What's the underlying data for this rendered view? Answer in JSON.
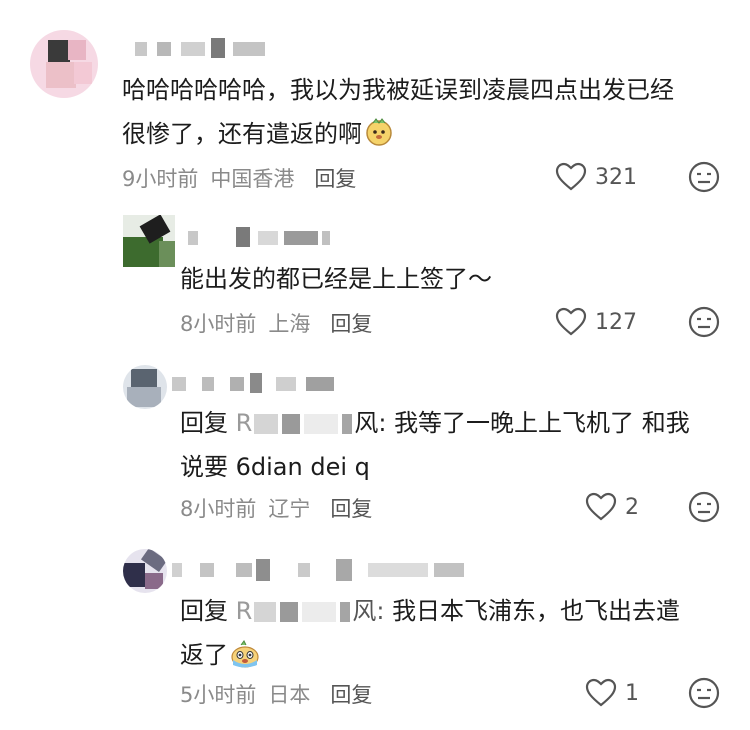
{
  "comments": [
    {
      "text_line1": "哈哈哈哈哈哈，我以为我被延误到凌晨四点出发已经",
      "text_line2": "很惨了，还有遣返的啊",
      "emoji": "face-emoji",
      "time": "9小时前",
      "location": "中国香港",
      "reply_label": "回复",
      "likes": "321"
    },
    {
      "text_line1": "能出发的都已经是上上签了～",
      "time": "8小时前",
      "location": "上海",
      "reply_label": "回复",
      "likes": "127"
    },
    {
      "reply_prefix": "回复",
      "mention_start": "R",
      "mention_end": "风:",
      "text_line1": "我等了一晚上上飞机了 和我",
      "text_line2": "说要 6dian dei q",
      "time": "8小时前",
      "location": "辽宁",
      "reply_label": "回复",
      "likes": "2"
    },
    {
      "reply_prefix": "回复",
      "mention_start": "R",
      "mention_end": "风:",
      "text_line1": "我日本飞浦东，也飞出去遣",
      "text_line2": "返了",
      "emoji": "crying-face-emoji",
      "time": "5小时前",
      "location": "日本",
      "reply_label": "回复",
      "likes": "1"
    }
  ],
  "icons": {
    "like": "heart-outline-icon",
    "dislike": "meh-face-icon"
  },
  "colors": {
    "text": "#1c1c1c",
    "meta": "#8a8a8a",
    "icon": "#555555"
  }
}
